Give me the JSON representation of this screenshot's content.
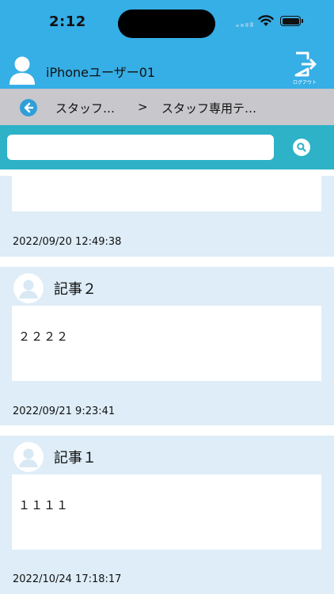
{
  "status_bar": {
    "time": "2:12"
  },
  "header": {
    "user_name": "iPhoneユーザー01",
    "logout_label": "ログアウト"
  },
  "breadcrumb": {
    "back_icon": "arrow-left-icon",
    "item1": "スタッフ…",
    "separator": ">",
    "item2": "スタッフ専用テ…"
  },
  "search": {
    "placeholder": "",
    "value": "",
    "icon": "search-icon"
  },
  "posts": [
    {
      "title": "",
      "body": "",
      "date": "2022/09/20 12:49:38"
    },
    {
      "title": "記事２",
      "body": "２２２２",
      "date": "2022/09/21 9:23:41"
    },
    {
      "title": "記事１",
      "body": "１１１１",
      "date": "2022/10/24 17:18:17"
    }
  ],
  "colors": {
    "header": "#36aee6",
    "breadcrumb": "#c7c7cc",
    "search_bar": "#2eb2c7",
    "post_bg": "#deedf7"
  }
}
